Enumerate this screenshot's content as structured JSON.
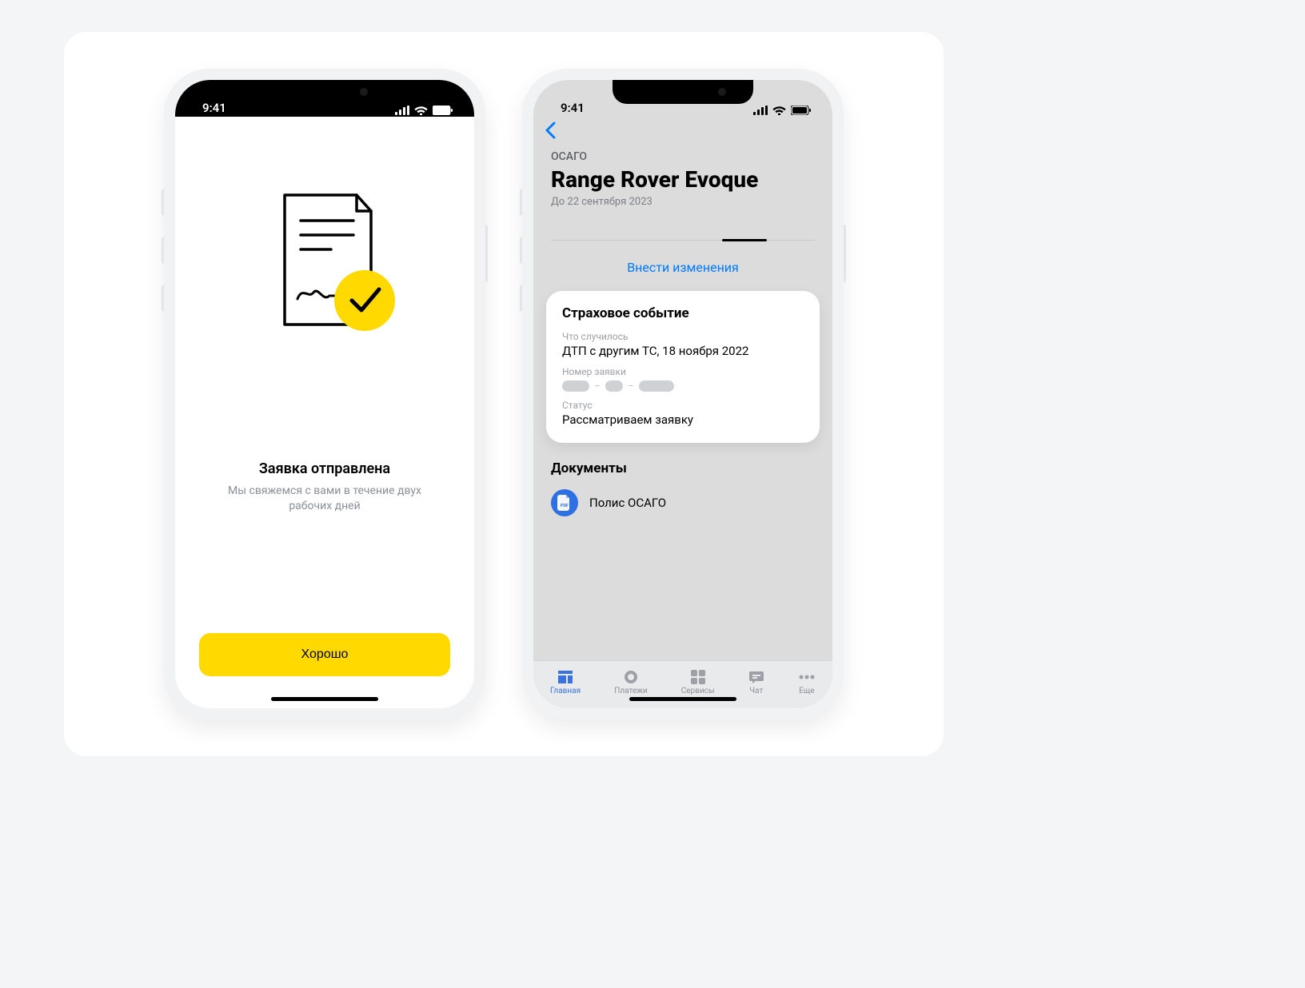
{
  "status_time": "9:41",
  "colors": {
    "accent_yellow": "#ffd900",
    "link_blue": "#007aff",
    "tab_active": "#3a72e0"
  },
  "phone1": {
    "title": "Заявка отправлена",
    "subtitle": "Мы свяжемся с вами в течение двух рабочих дней",
    "button": "Хорошо"
  },
  "phone2": {
    "eyebrow": "ОСАГО",
    "title": "Range Rover Evoque",
    "until": "До 22 сентября 2023",
    "change_link": "Внести изменения",
    "event_card": {
      "heading": "Страховое событие",
      "what_label": "Что случилось",
      "what_value": "ДТП с другим ТС, 18 ноября 2022",
      "number_label": "Номер заявки",
      "status_label": "Статус",
      "status_value": "Рассматриваем заявку"
    },
    "docs_heading": "Документы",
    "doc_item": "Полис ОСАГО",
    "tabs": [
      {
        "label": "Главная"
      },
      {
        "label": "Платежи"
      },
      {
        "label": "Сервисы"
      },
      {
        "label": "Чат"
      },
      {
        "label": "Еще"
      }
    ]
  }
}
